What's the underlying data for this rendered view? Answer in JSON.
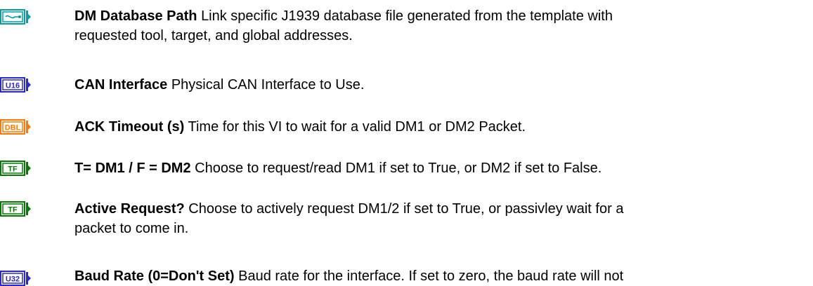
{
  "colors": {
    "path": "#00a0a0",
    "integer": "#2a2acc",
    "double": "#ff7a00",
    "boolean": "#007a00"
  },
  "entries": [
    {
      "type_label": "",
      "type_icon": "path-terminal-icon",
      "color_key": "path",
      "name": "DM Database Path",
      "line1": "Link specific J1939 database file generated from the template with",
      "line2": "requested tool, target, and global addresses."
    },
    {
      "type_label": "U16",
      "type_icon": "u16-terminal-icon",
      "color_key": "integer",
      "name": "CAN Interface",
      "line1": "Physical CAN Interface to Use.",
      "line2": ""
    },
    {
      "type_label": "DBL",
      "type_icon": "dbl-terminal-icon",
      "color_key": "double",
      "name": "ACK Timeout (s)",
      "line1": "Time for this VI to wait for a valid DM1 or DM2 Packet.",
      "line2": ""
    },
    {
      "type_label": "TF",
      "type_icon": "tf-terminal-icon",
      "color_key": "boolean",
      "name": "T= DM1 / F = DM2",
      "line1": "Choose to request/read DM1 if set to True, or DM2 if set to False.",
      "line2": ""
    },
    {
      "type_label": "TF",
      "type_icon": "tf-terminal-icon",
      "color_key": "boolean",
      "name": "Active Request?",
      "line1": "Choose to actively request DM1/2 if set to True, or passivley wait for a",
      "line2": "packet to come in."
    },
    {
      "type_label": "U32",
      "type_icon": "u32-terminal-icon",
      "color_key": "integer",
      "name": "Baud Rate (0=Don't Set)",
      "line1": "Baud rate for the interface.  If set to zero, the baud rate will not",
      "line2": ""
    }
  ]
}
